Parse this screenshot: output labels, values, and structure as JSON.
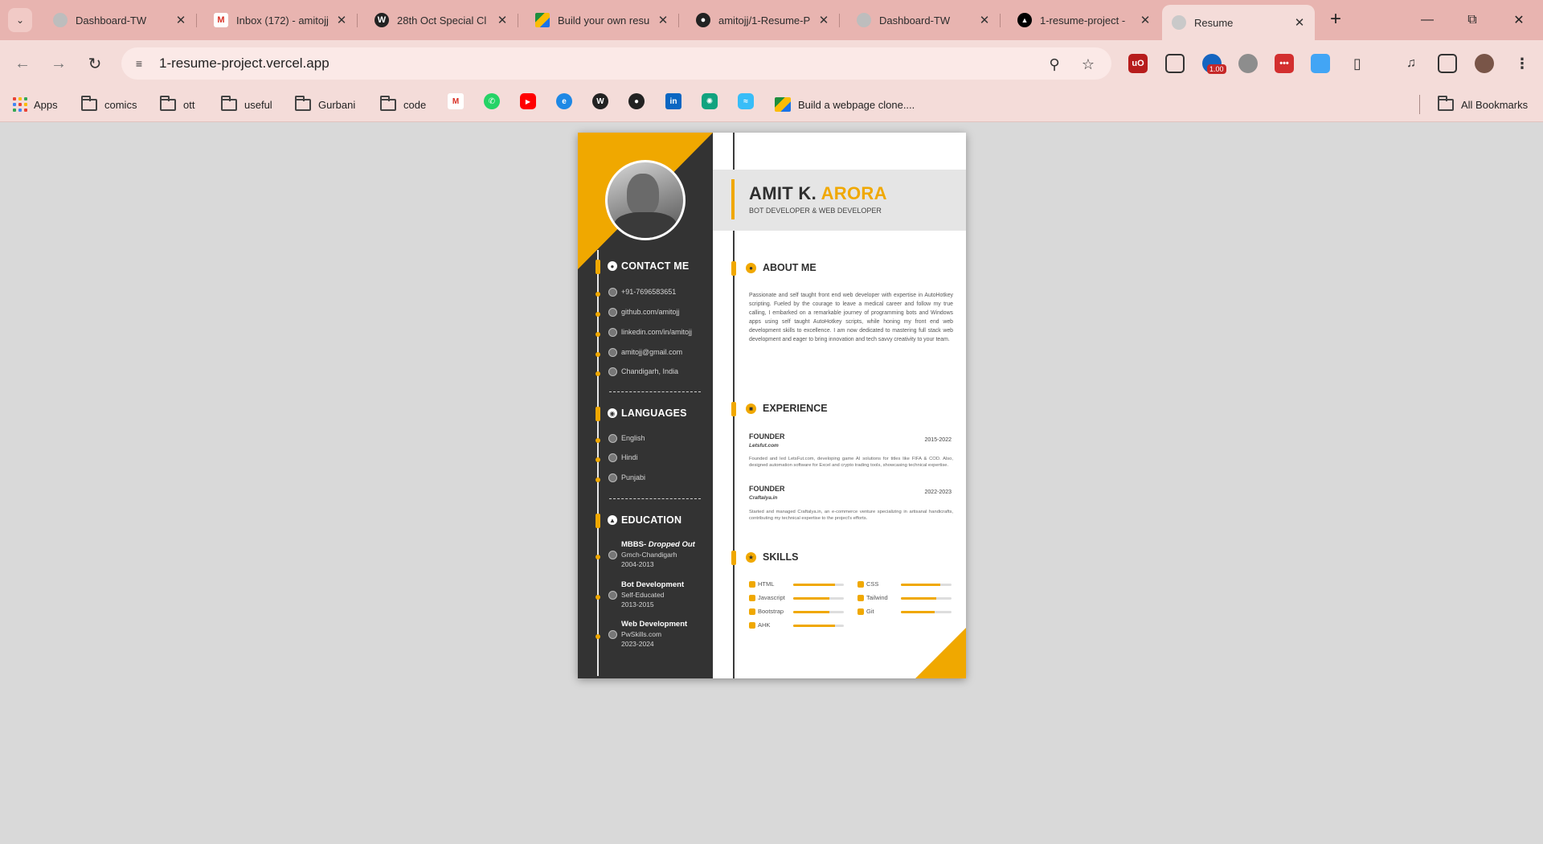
{
  "browser": {
    "tabs": [
      {
        "title": "Dashboard-TW",
        "favicon": "dashboard-globe-icon"
      },
      {
        "title": "Inbox (172) - amitojj",
        "favicon": "gmail-icon"
      },
      {
        "title": "28th Oct Special Cl",
        "favicon": "wordpress-icon"
      },
      {
        "title": "Build your own resu",
        "favicon": "google-drive-icon"
      },
      {
        "title": "amitojj/1-Resume-P",
        "favicon": "github-icon"
      },
      {
        "title": "Dashboard-TW",
        "favicon": "dashboard-globe-icon"
      },
      {
        "title": "1-resume-project -",
        "favicon": "vercel-icon"
      },
      {
        "title": "Resume",
        "favicon": "globe-icon"
      }
    ],
    "active_tab_index": 7,
    "url": "1-resume-project.vercel.app",
    "extension_badge": "1.00",
    "bookmarks": {
      "apps": "Apps",
      "folders": [
        "comics",
        "ott",
        "useful",
        "Gurbani",
        "code"
      ],
      "link": "Build a webpage clone....",
      "all": "All Bookmarks"
    }
  },
  "resume": {
    "first_name": "AMIT K.",
    "last_name": "ARORA",
    "role": "BOT DEVELOPER & WEB DEVELOPER",
    "accent_color": "#f0a800",
    "dark_color": "#333333",
    "contact_title": "CONTACT ME",
    "contact": [
      {
        "icon": "phone-icon",
        "text": "+91-7696583651"
      },
      {
        "icon": "github-icon",
        "text": "github.com/amitojj"
      },
      {
        "icon": "linkedin-icon",
        "text": "linkedin.com/in/amitojj"
      },
      {
        "icon": "email-icon",
        "text": "amitojj@gmail.com"
      },
      {
        "icon": "location-icon",
        "text": "Chandigarh, India"
      }
    ],
    "languages_title": "LANGUAGES",
    "languages": [
      "English",
      "Hindi",
      "Punjabi"
    ],
    "education_title": "EDUCATION",
    "education": [
      {
        "title": "MBBS-",
        "note": "Dropped Out",
        "place": "Gmch-Chandigarh",
        "years": "2004-2013"
      },
      {
        "title": "Bot Development",
        "note": "",
        "place": "Self-Educated",
        "years": "2013-2015"
      },
      {
        "title": "Web Development",
        "note": "",
        "place": "PwSkills.com",
        "years": "2023-2024"
      }
    ],
    "about_title": "ABOUT ME",
    "about": "Passionate and self taught front end web developer with expertise in AutoHotkey scripting. Fueled by the courage to leave a medical career and follow my true calling, I embarked on a remarkable journey of programming bots and Windows apps using self taught AutoHotkey scripts, while honing my front end web development skills to excellence. I am now dedicated to mastering full stack web development and eager to bring innovation and tech savvy creativity to your team.",
    "experience_title": "EXPERIENCE",
    "experience": [
      {
        "title": "FOUNDER",
        "company": "Letsfut.com",
        "years": "2015-2022",
        "desc": "Founded and led LetsFut.com, developing game AI solutions for titles like FIFA & COD. Also, designed automation software for Excel and crypto trading tools, showcasing technical expertise."
      },
      {
        "title": "FOUNDER",
        "company": "Craftalya.in",
        "years": "2022-2023",
        "desc": "Started and managed Craftalya.in, an e-commerce venture specializing in artisanal handicrafts, contributing my technical expertise to the project's efforts."
      }
    ],
    "skills_title": "SKILLS",
    "skills": [
      {
        "name": "HTML",
        "level": 0.82
      },
      {
        "name": "CSS",
        "level": 0.78
      },
      {
        "name": "Javascript",
        "level": 0.72
      },
      {
        "name": "Tailwind",
        "level": 0.7
      },
      {
        "name": "Bootstrap",
        "level": 0.72
      },
      {
        "name": "Git",
        "level": 0.66
      },
      {
        "name": "AHK",
        "level": 0.82
      }
    ]
  }
}
